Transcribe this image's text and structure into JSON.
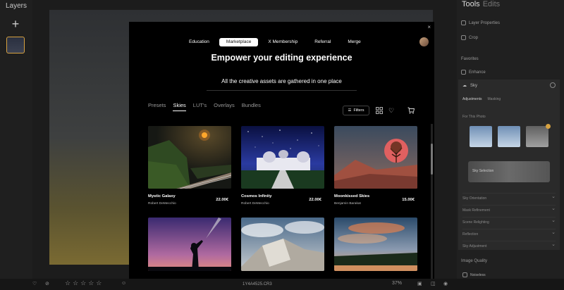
{
  "layers": {
    "title": "Layers",
    "add_label": "+"
  },
  "tools": {
    "title": "Tools",
    "edits": "Edits",
    "layer_properties": "Layer Properties",
    "crop": "Crop",
    "favorites": "Favorites",
    "enhance": "Enhance",
    "sky": "Sky",
    "tabs": [
      "Adjustments",
      "Masking"
    ],
    "for_this_photo": "For This Photo",
    "sky_selection": "Sky Selection",
    "sections": [
      "Sky Orientation",
      "Mask Refinement",
      "Scene Relighting",
      "Reflection",
      "Sky Adjustment"
    ],
    "image_quality": "Image Quality",
    "noiseless": "Noiseless"
  },
  "status_bar": {
    "filename": "1Y4A4525.CR3",
    "zoom": "37%",
    "stars": "☆☆☆☆☆"
  },
  "modal": {
    "close": "×",
    "nav": [
      "Education",
      "Marketplace",
      "X Membership",
      "Referral",
      "Merge"
    ],
    "active_nav": "Marketplace",
    "title": "Empower your editing experience",
    "subtitle": "All the creative assets are gathered in one place",
    "categories": [
      "Presets",
      "Skies",
      "LUT's",
      "Overlays",
      "Bundles"
    ],
    "active_category": "Skies",
    "filters": "Filters",
    "cards": [
      {
        "name": "Mystic Galaxy",
        "author": "Robert DeMecchio",
        "price": "22.00€"
      },
      {
        "name": "Cosmos Infinity",
        "author": "Robert DeMecchio",
        "price": "22.00€"
      },
      {
        "name": "Moonkissed Skies",
        "author": "Benjamin Barakat",
        "price": "15.00€"
      }
    ]
  }
}
